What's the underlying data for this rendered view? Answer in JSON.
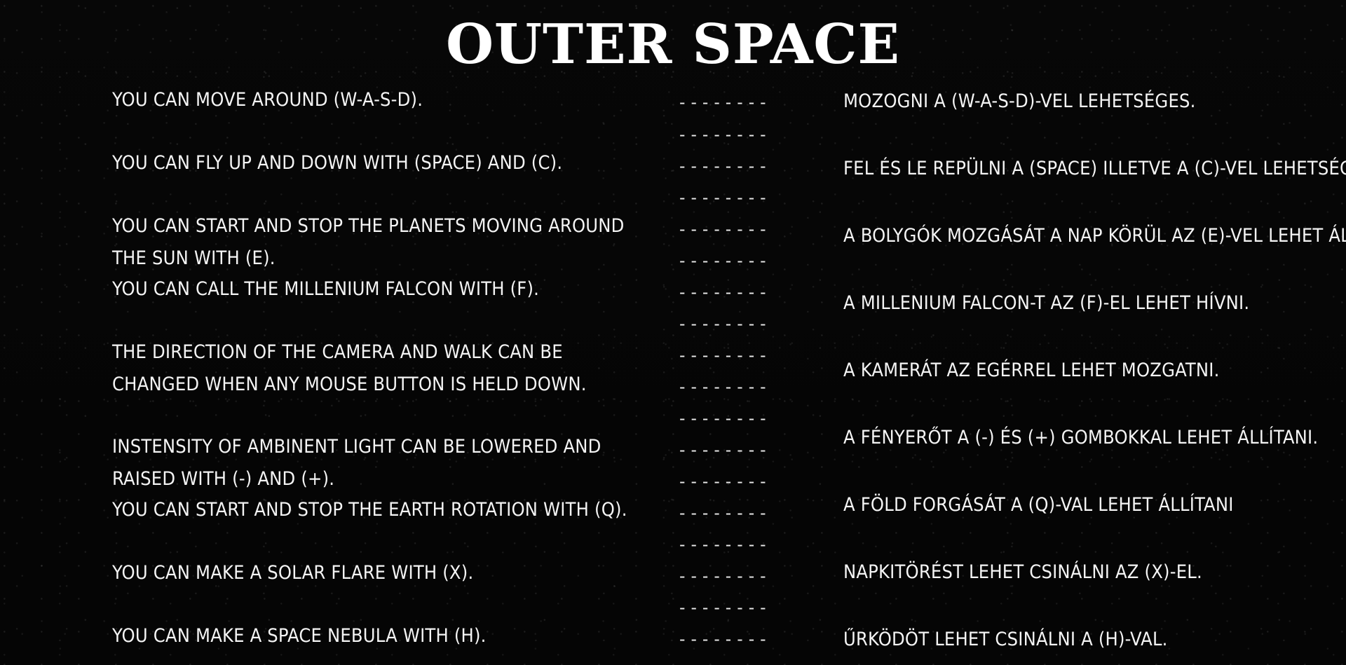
{
  "title": "OUTER SPACE",
  "rows": [
    {
      "english": "YOU CAN MOVE AROUND (W-A-S-D).",
      "hungarian": "MOZOGNI A (W-A-S-D)-VEL LEHETSÉGES."
    },
    {
      "english": "YOU CAN FLY UP AND DOWN WITH (SPACE) AND (C).",
      "hungarian": "FEL ÉS LE REPÜLNI A (SPACE) ILLETVE A (C)-VEL LEHETSÉGES."
    },
    {
      "english": "YOU CAN START AND STOP THE PLANETS MOVING AROUND THE SUN WITH (E).",
      "hungarian": "A BOLYGÓK MOZGÁSÁT A NAP KÖRÜL AZ (E)-VEL LEHET ÁLLÍTANI."
    },
    {
      "english": "YOU CAN CALL THE MILLENIUM FALCON WITH (F).",
      "hungarian": "A MILLENIUM FALCON-T AZ (F)-EL LEHET HÍVNI."
    },
    {
      "english": "THE DIRECTION OF THE CAMERA AND WALK CAN BE CHANGED WHEN ANY MOUSE BUTTON IS HELD DOWN.",
      "hungarian": "A KAMERÁT AZ EGÉRREL LEHET MOZGATNI."
    },
    {
      "english": "INSTENSITY OF AMBINENT LIGHT CAN BE LOWERED AND RAISED WITH (-) AND (+).",
      "hungarian": "A FÉNYERŐT A (-) ÉS (+) GOMBOKKAL LEHET ÁLLÍTANI."
    },
    {
      "english": "YOU CAN START AND STOP THE EARTH ROTATION WITH (Q).",
      "hungarian": "A FÖLD FORGÁSÁT A (Q)-VAL LEHET ÁLLÍTANI"
    },
    {
      "english": "YOU CAN MAKE A SOLAR FLARE WITH (X).",
      "hungarian": "NAPKITÖRÉST LEHET CSINÁLNI AZ (X)-EL."
    },
    {
      "english": "YOU CAN MAKE A SPACE NEBULA WITH (H).",
      "hungarian": "ŰRKÖDÖT LEHET CSINÁLNI A (H)-VAL."
    }
  ],
  "separator": "--------"
}
